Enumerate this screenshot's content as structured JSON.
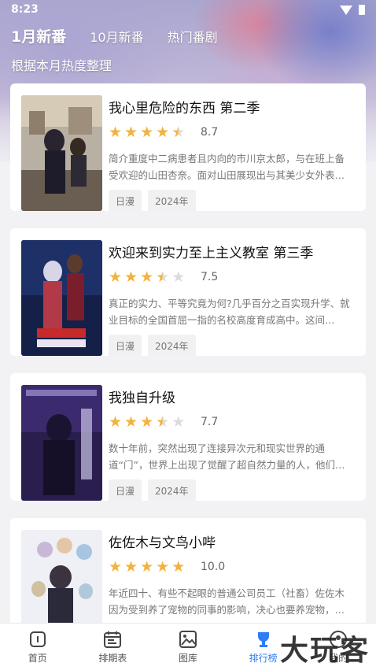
{
  "status": {
    "time": "8:23"
  },
  "tabs": [
    {
      "label": "1月新番",
      "active": true
    },
    {
      "label": "10月新番",
      "active": false
    },
    {
      "label": "热门番剧",
      "active": false
    }
  ],
  "subtitle": "根据本月热度整理",
  "cards": [
    {
      "title": "我心里危险的东西 第二季",
      "rating": 4.5,
      "score": "8.7",
      "desc": "简介重度中二病患者且内向的市川京太郎，与在班上备受欢迎的山田杏奈。面对山田展现出与其美少女外表…",
      "tags": [
        "日漫",
        "2024年"
      ]
    },
    {
      "title": "欢迎来到实力至上主义教室 第三季",
      "rating": 3.5,
      "score": "7.5",
      "desc": "真正的实力、平等究竟为何?几乎百分之百实现升学、就业目标的全国首屈一指的名校高度育成高中。这间…",
      "tags": [
        "日漫",
        "2024年"
      ]
    },
    {
      "title": "我独自升级",
      "rating": 3.5,
      "score": "7.7",
      "desc": "数十年前，突然出现了连接异次元和现实世界的通道“门”，世界上出现了觉醒了超自然力量的人，他们…",
      "tags": [
        "日漫",
        "2024年"
      ]
    },
    {
      "title": "佐佐木与文鸟小哔",
      "rating": 5,
      "score": "10.0",
      "desc": "年近四十、有些不起眼的普通公司员工（社畜）佐佐木因为受到养了宠物的同事的影响，决心也要养宠物，…",
      "tags": [
        "日漫",
        "2024年"
      ]
    }
  ],
  "nav": [
    {
      "label": "首页",
      "icon": "home-icon",
      "active": false
    },
    {
      "label": "排期表",
      "icon": "calendar-icon",
      "active": false
    },
    {
      "label": "图库",
      "icon": "gallery-icon",
      "active": false
    },
    {
      "label": "排行榜",
      "icon": "trophy-icon",
      "active": true
    },
    {
      "label": "我的",
      "icon": "user-icon",
      "active": false
    }
  ],
  "watermark": "大玩客",
  "colors": {
    "accent": "#2f7df6",
    "star": "#f4b23c"
  }
}
